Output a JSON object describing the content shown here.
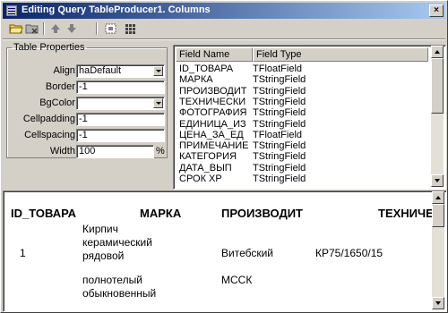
{
  "window": {
    "title": "Editing Query TableProducer1. Columns",
    "title_buttons": {
      "close": "×"
    }
  },
  "toolbar": {
    "icons": [
      "open-folder-icon",
      "folder-delete-icon",
      "move-up-arrow-icon",
      "move-down-arrow-icon",
      "select-all-icon",
      "grid-icon"
    ]
  },
  "table_properties": {
    "legend": "Table Properties",
    "align_label": "Align:",
    "align_value": "haDefault",
    "border_label": "Border:",
    "border_value": "-1",
    "bgcolor_label": "BgColor:",
    "bgcolor_value": "",
    "cellpadding_label": "Cellpadding:",
    "cellpadding_value": "-1",
    "cellspacing_label": "Cellspacing:",
    "cellspacing_value": "-1",
    "width_label": "Width:",
    "width_value": "100",
    "width_unit": "%"
  },
  "fields": {
    "col_name": "Field Name",
    "col_type": "Field Type",
    "rows": [
      {
        "name": "ID_ТОВАРА",
        "type": "TFloatField"
      },
      {
        "name": "МАРКА",
        "type": "TStringField"
      },
      {
        "name": "ПРОИЗВОДИТ",
        "type": "TStringField"
      },
      {
        "name": "ТЕХНИЧЕСКИ",
        "type": "TStringField"
      },
      {
        "name": "ФОТОГРАФИЯ",
        "type": "TStringField"
      },
      {
        "name": "ЕДИНИЦА_ИЗ",
        "type": "TStringField"
      },
      {
        "name": "ЦЕНА_ЗА_ЕД",
        "type": "TFloatField"
      },
      {
        "name": "ПРИМЕЧАНИЕ",
        "type": "TStringField"
      },
      {
        "name": "КАТЕГОРИЯ",
        "type": "TStringField"
      },
      {
        "name": "ДАТА_ВЫП",
        "type": "TStringField"
      },
      {
        "name": "СРОК ХР",
        "type": "TStringField"
      }
    ]
  },
  "preview": {
    "headers": [
      "ID_ТОВАРА",
      "МАРКА",
      "ПРОИЗВОДИТ",
      "ТЕХНИЧЕ"
    ],
    "row1": {
      "id": "1",
      "marka_lines": [
        "Кирпич",
        "керамический",
        "рядовой"
      ],
      "maker": "Витебский",
      "tech": "КР75/1650/15"
    },
    "row2": {
      "marka_lines": [
        "полнотелый",
        "обыкновенный"
      ],
      "maker": "МССК"
    }
  }
}
